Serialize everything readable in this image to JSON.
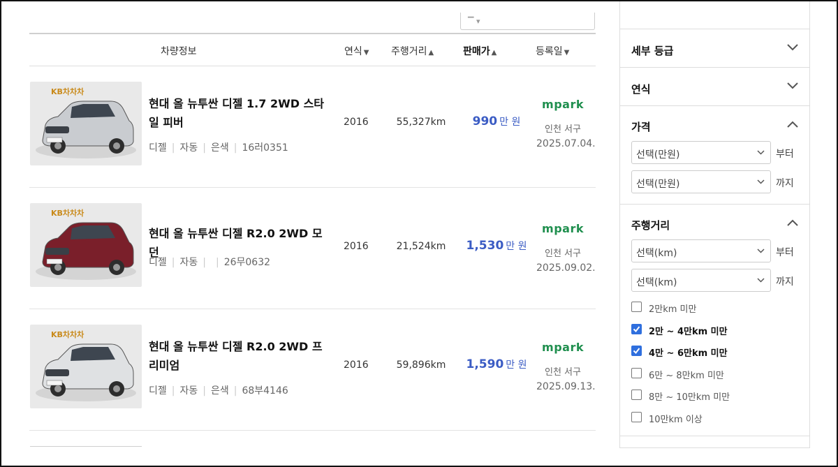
{
  "table_header": {
    "vehicle_info": "차량정보",
    "year": "연식",
    "mileage": "주행거리",
    "price": "판매가",
    "registered": "등록일"
  },
  "listings": [
    {
      "badge": "KB차차차",
      "title": "현대 올 뉴투싼 디젤 1.7 2WD 스타일 피버",
      "fuel": "디젤",
      "transmission": "자동",
      "color": "은색",
      "plate": "16러0351",
      "year": "2016",
      "mileage": "55,327km",
      "price": "990",
      "price_unit": "만 원",
      "dealer_logo": "mpark",
      "location": "인천 서구",
      "date": "2025.07.04.",
      "car_color_hex": "#c9ccd0"
    },
    {
      "badge": "KB차차차",
      "title": "현대 올 뉴투싼 디젤 R2.0 2WD 모던",
      "fuel": "디젤",
      "transmission": "자동",
      "color": "",
      "plate": "26무0632",
      "year": "2016",
      "mileage": "21,524km",
      "price": "1,530",
      "price_unit": "만 원",
      "dealer_logo": "mpark",
      "location": "인천 서구",
      "date": "2025.09.02.",
      "car_color_hex": "#7a1f2a"
    },
    {
      "badge": "KB차차차",
      "title": "현대 올 뉴투싼 디젤 R2.0 2WD 프리미엄",
      "fuel": "디젤",
      "transmission": "자동",
      "color": "은색",
      "plate": "68부4146",
      "year": "2016",
      "mileage": "59,896km",
      "price": "1,590",
      "price_unit": "만 원",
      "dealer_logo": "mpark",
      "location": "인천 서구",
      "date": "2025.09.13.",
      "car_color_hex": "#dfe1e3"
    }
  ],
  "sidebar": {
    "detail_grade": {
      "title": "세부 등급",
      "expanded": false
    },
    "year": {
      "title": "연식",
      "expanded": false
    },
    "price": {
      "title": "가격",
      "expanded": true,
      "from_select": "선택(만원)",
      "from_suffix": "부터",
      "to_select": "선택(만원)",
      "to_suffix": "까지"
    },
    "mileage": {
      "title": "주행거리",
      "expanded": true,
      "from_select": "선택(km)",
      "from_suffix": "부터",
      "to_select": "선택(km)",
      "to_suffix": "까지",
      "options": [
        {
          "label": "2만km 미만",
          "checked": false
        },
        {
          "label": "2만 ~ 4만km 미만",
          "checked": true
        },
        {
          "label": "4만 ~ 6만km 미만",
          "checked": true
        },
        {
          "label": "6만 ~ 8만km 미만",
          "checked": false
        },
        {
          "label": "8만 ~ 10만km 미만",
          "checked": false
        },
        {
          "label": "10만km 이상",
          "checked": false
        }
      ]
    }
  },
  "colors": {
    "price_accent": "#3b5cc4",
    "dealer_logo": "#1f8f4e",
    "checkbox_on": "#2f6fde"
  }
}
